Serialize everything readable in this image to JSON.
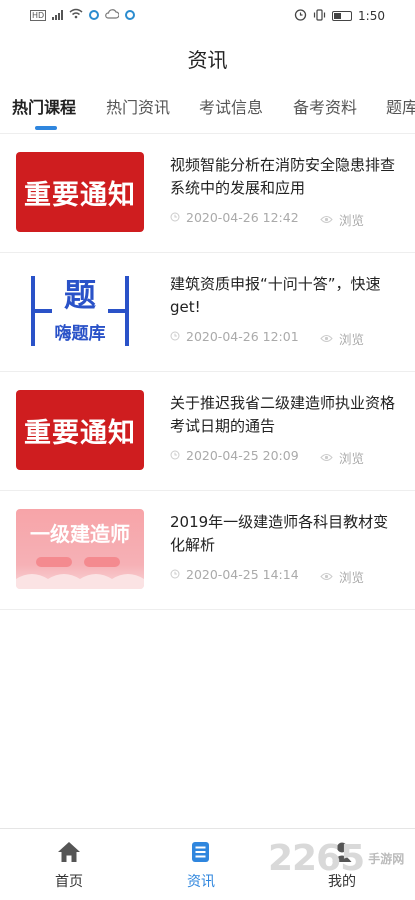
{
  "status_bar": {
    "time": "1:50",
    "hd_label": "HD"
  },
  "header": {
    "title": "资讯"
  },
  "tabs": [
    {
      "label": "热门课程",
      "active": true
    },
    {
      "label": "热门资讯",
      "active": false
    },
    {
      "label": "考试信息",
      "active": false
    },
    {
      "label": "备考资料",
      "active": false
    },
    {
      "label": "题库",
      "active": false
    }
  ],
  "articles": [
    {
      "title": "视频智能分析在消防安全隐患排查系统中的发展和应用",
      "datetime": "2020-04-26 12:42",
      "views_label": "浏览",
      "thumb_text": "重要通知"
    },
    {
      "title": "建筑资质申报“十问十答”，快速get!",
      "datetime": "2020-04-26 12:01",
      "views_label": "浏览",
      "thumb_text": "题",
      "thumb_sub": "嗨题库"
    },
    {
      "title": "关于推迟我省二级建造师执业资格考试日期的通告",
      "datetime": "2020-04-25 20:09",
      "views_label": "浏览",
      "thumb_text": "重要通知"
    },
    {
      "title": "2019年一级建造师各科目教材变化解析",
      "datetime": "2020-04-25 14:14",
      "views_label": "浏览",
      "thumb_text": "一级建造师"
    }
  ],
  "bottom_nav": [
    {
      "label": "首页",
      "icon": "home-icon",
      "active": false
    },
    {
      "label": "资讯",
      "icon": "news-icon",
      "active": true
    },
    {
      "label": "我的",
      "icon": "profile-icon",
      "active": false
    }
  ],
  "watermark": {
    "number": "2265",
    "text": "手游网"
  },
  "colors": {
    "accent": "#2f86de",
    "notice_red": "#cf1d1f",
    "thumb_blue": "#2a52c8"
  }
}
